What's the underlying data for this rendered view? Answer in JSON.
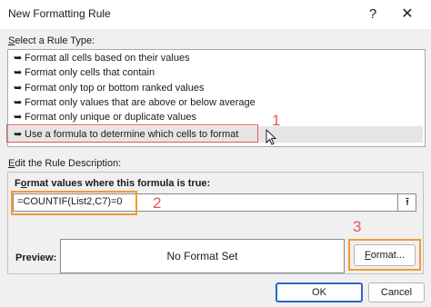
{
  "window": {
    "title": "New Formatting Rule",
    "help_label": "?",
    "close_label": "✕"
  },
  "rule_type": {
    "label_prefix": "",
    "label_accel": "S",
    "label_rest": "elect a Rule Type:",
    "items": [
      {
        "label": "Format all cells based on their values"
      },
      {
        "label": "Format only cells that contain"
      },
      {
        "label": "Format only top or bottom ranked values"
      },
      {
        "label": "Format only values that are above or below average"
      },
      {
        "label": "Format only unique or duplicate values"
      },
      {
        "label": "Use a formula to determine which cells to format"
      }
    ],
    "selected_index": 5,
    "item_arrow": "➥"
  },
  "description": {
    "label_prefix": "",
    "label_accel": "E",
    "label_rest": "dit the Rule Description:",
    "formula_label_prefix": "F",
    "formula_label_accel": "o",
    "formula_label_rest": "rmat values where this formula is true:",
    "formula_value": "=COUNTIF(List2,C7)=0",
    "collapse_icon": "⭱",
    "preview_label": "Preview:",
    "preview_text": "No Format Set",
    "format_button_accel": "F",
    "format_button_rest": "ormat..."
  },
  "buttons": {
    "ok": "OK",
    "cancel": "Cancel"
  },
  "annotations": {
    "num1": "1",
    "num2": "2",
    "num3": "3"
  },
  "colors": {
    "highlight_red": "#e0585a",
    "highlight_orange": "#f39a36",
    "ok_border": "#2b66c9"
  }
}
